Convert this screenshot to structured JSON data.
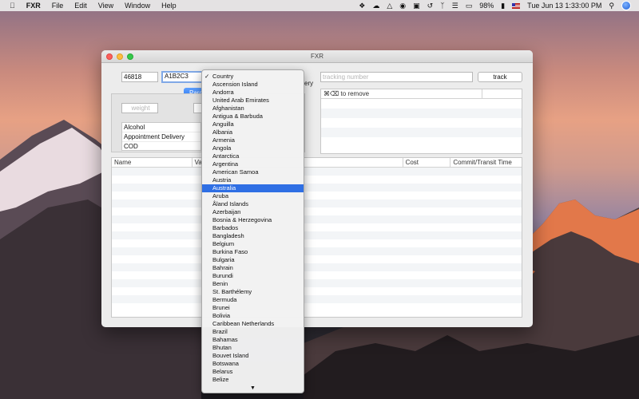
{
  "menubar": {
    "app_name": "FXR",
    "items": [
      "File",
      "Edit",
      "View",
      "Window",
      "Help"
    ],
    "battery": "98%",
    "clock": "Tue Jun 13  1:33:00 PM",
    "status_icons": [
      "dropbox-icon",
      "cloud-icon",
      "drive-icon",
      "location-icon",
      "window-icon",
      "time-machine-icon",
      "bluetooth-icon",
      "wifi-icon",
      "airplay-icon",
      "battery-icon",
      "flag-icon",
      "search-icon",
      "siri-icon"
    ]
  },
  "window": {
    "title": "FXR"
  },
  "form": {
    "zip_from": "46818",
    "postal_to": "A1B2C3",
    "tab_label": "Parc",
    "delivery_partial": "ery",
    "weight_placeholder": "weight",
    "tracking_placeholder": "tracking number",
    "track_button": "track",
    "remove_hint": "⌘⌫ to remove"
  },
  "options": [
    "Alcohol",
    "Appointment Delivery",
    "COD"
  ],
  "results": {
    "columns": [
      "Name",
      "Va",
      "Cost",
      "Commit/Transit Time"
    ]
  },
  "country_menu": {
    "checked": "Country",
    "selected": "Australia",
    "items": [
      "Country",
      "Ascension Island",
      "Andorra",
      "United Arab Emirates",
      "Afghanistan",
      "Antigua & Barbuda",
      "Anguilla",
      "Albania",
      "Armenia",
      "Angola",
      "Antarctica",
      "Argentina",
      "American Samoa",
      "Austria",
      "Australia",
      "Aruba",
      "Åland Islands",
      "Azerbaijan",
      "Bosnia & Herzegovina",
      "Barbados",
      "Bangladesh",
      "Belgium",
      "Burkina Faso",
      "Bulgaria",
      "Bahrain",
      "Burundi",
      "Benin",
      "St. Barthélemy",
      "Bermuda",
      "Brunei",
      "Bolivia",
      "Caribbean Netherlands",
      "Brazil",
      "Bahamas",
      "Bhutan",
      "Bouvet Island",
      "Botswana",
      "Belarus",
      "Belize"
    ],
    "scroll_arrow": "▼"
  }
}
